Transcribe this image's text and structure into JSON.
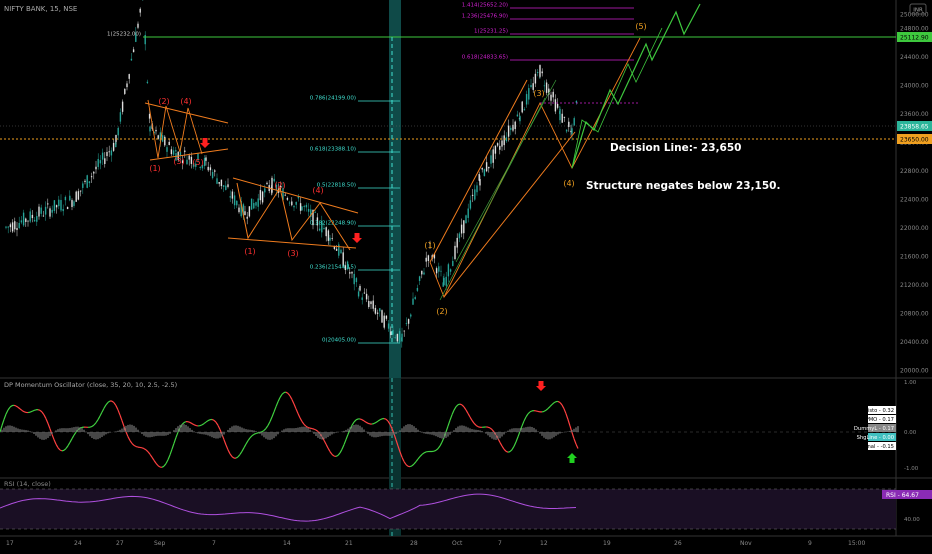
{
  "header": {
    "symbol": "NIFTY BANK, 15, NSE"
  },
  "price_axis": {
    "ticks": [
      "25000.00",
      "24800.00",
      "24400.00",
      "24000.00",
      "23600.00",
      "23200.00",
      "22800.00",
      "22400.00",
      "22000.00",
      "21600.00",
      "21200.00",
      "20800.00",
      "20400.00",
      "20000.00"
    ],
    "badge_last": "23858.65",
    "badge_green": "25112.90",
    "badge_decision": "23650.00",
    "inr_label": "INR"
  },
  "time_axis": {
    "labels": [
      "17",
      "24",
      "27",
      "Sep",
      "7",
      "14",
      "21",
      "28",
      "Oct",
      "7",
      "12",
      "19",
      "26",
      "Nov",
      "9",
      "15:00"
    ]
  },
  "fib_levels": [
    {
      "label": "1.414(25652.20)",
      "color": "#d020d0"
    },
    {
      "label": "1.236(25476.90)",
      "color": "#d020d0"
    },
    {
      "label": "1(25231.25)",
      "color": "#d020d0"
    },
    {
      "label": "0.618(24833.65)",
      "color": "#d020d0"
    },
    {
      "label": "1(25232.00)",
      "color": "#cccccc"
    },
    {
      "label": "0.786(24199.00)",
      "color": "#40e0d0"
    },
    {
      "label": "0.618(23388.10)",
      "color": "#40e0d0"
    },
    {
      "label": "0.5(22818.50)",
      "color": "#40e0d0"
    },
    {
      "label": "0.382(22248.90)",
      "color": "#40e0d0"
    },
    {
      "label": "0.236(21544.15)",
      "color": "#40e0d0"
    },
    {
      "label": "0(20405.00)",
      "color": "#40e0d0"
    }
  ],
  "annotations": {
    "decision_line": "Decision Line:- 23,650",
    "structure": "Structure negates below 23,150."
  },
  "wave_labels": {
    "w1a": "(1)",
    "w2a": "(2)",
    "w3a": "(3)",
    "w4a": "(4)",
    "w5a": "(5)",
    "w1b": "(1)",
    "w2b": "(2)",
    "w3b": "(3)",
    "w4b": "(4)",
    "w1c": "(1)",
    "w2c": "(2)",
    "w3c": "(3)",
    "w4c": "(4)",
    "w5c": "(5)"
  },
  "oscillator": {
    "title": "DP Momentum Oscillator (close, 35, 20, 10, 2.5, -2.5)",
    "ticks": [
      "1.00",
      "0.00",
      "-1.00"
    ],
    "legend": [
      {
        "label": "Histo - 0.32",
        "bg": "#ffffff",
        "fg": "#000000"
      },
      {
        "label": "PMO - 0.17",
        "bg": "#ffffff",
        "fg": "#000000"
      },
      {
        "label": "DummyL - 0.17",
        "bg": "#888888",
        "fg": "#ffffff"
      },
      {
        "label": "ShgLine - 0.00",
        "bg": "#40c0c0",
        "fg": "#ffffff"
      },
      {
        "label": "PMO Signal - -0.15",
        "bg": "#ffffff",
        "fg": "#000000"
      }
    ]
  },
  "rsi": {
    "title": "RSI (14, close)",
    "badge": "RSI - 64.67",
    "ticks": [
      "40.00"
    ]
  },
  "chart_data": {
    "type": "candlestick",
    "title": "NIFTY BANK, 15, NSE",
    "ylim": [
      20000,
      25400
    ],
    "price_path": [
      [
        "17 Aug",
        22000
      ],
      [
        "24 Aug",
        22400
      ],
      [
        "27 Aug",
        23200
      ],
      [
        "28 Aug",
        25232
      ],
      [
        "30 Aug",
        23400
      ],
      [
        "Sep",
        23300
      ],
      [
        "2 Sep",
        23050
      ],
      [
        "7 Sep",
        22900
      ],
      [
        "11 Sep",
        22200
      ],
      [
        "14 Sep",
        22600
      ],
      [
        "17 Sep",
        22300
      ],
      [
        "21 Sep",
        21900
      ],
      [
        "23 Sep",
        21100
      ],
      [
        "26 Sep",
        20405
      ],
      [
        "29 Sep",
        21700
      ],
      [
        "Oct",
        21200
      ],
      [
        "5 Oct",
        22700
      ],
      [
        "9 Oct",
        23600
      ],
      [
        "12 Oct",
        24199
      ],
      [
        "14 Oct",
        23600
      ],
      [
        "15 Oct",
        23300
      ],
      [
        "16 Oct",
        23858.65
      ]
    ],
    "last_price": 23858.65,
    "projection_path": [
      [
        "16 Oct",
        23858.65
      ],
      [
        "17 Oct",
        24400
      ],
      [
        "18 Oct",
        24100
      ],
      [
        "22 Oct",
        24800
      ],
      [
        "25 Oct",
        25476.9
      ],
      [
        "27 Oct",
        25300
      ],
      [
        "30 Oct",
        25650
      ]
    ],
    "levels": {
      "decision": 23650,
      "structure_negation": 23150,
      "resistance": 25112.9
    },
    "series": [
      {
        "name": "Histo",
        "last": 0.32
      },
      {
        "name": "PMO",
        "last": 0.17
      },
      {
        "name": "DummyL",
        "last": 0.17
      },
      {
        "name": "ShgLine",
        "last": 0.0
      },
      {
        "name": "PMO Signal",
        "last": -0.15
      },
      {
        "name": "RSI",
        "last": 64.67
      }
    ]
  }
}
